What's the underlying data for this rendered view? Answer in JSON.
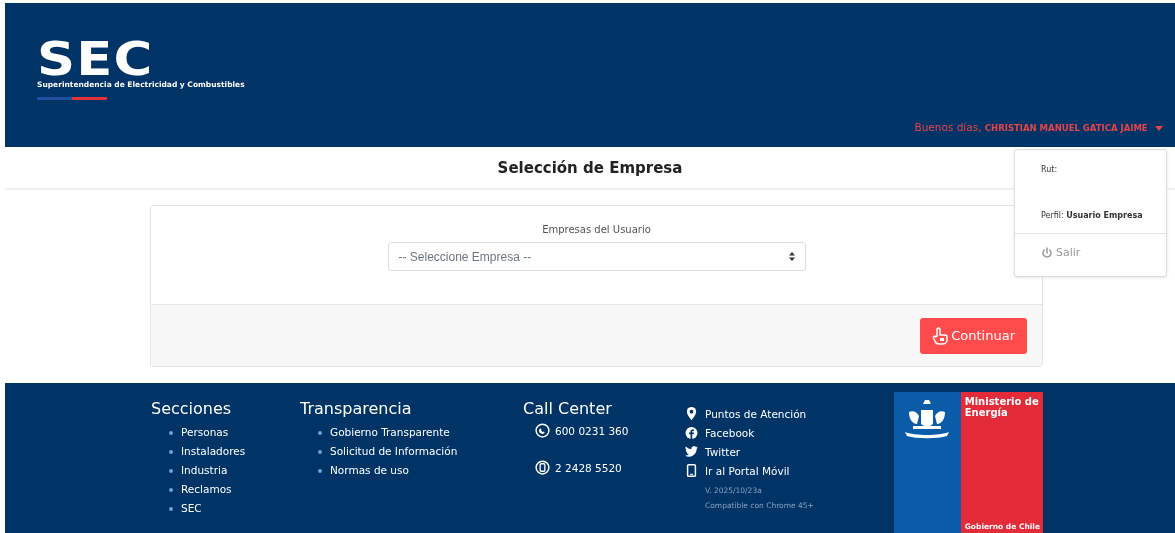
{
  "header": {
    "logo_mark": "SEC",
    "logo_text": "Superintendencia de Electricidad y Combustibles",
    "greeting": "Buenos días,",
    "user_name": "CHRISTIAN MANUEL GATICA JAIME",
    "menu_expanded": true
  },
  "user_menu": {
    "rut_label": "Rut:",
    "profile_label": "Perfil:",
    "profile_value": "Usuario Empresa",
    "logout": "Salir"
  },
  "page_title": "Selección de Empresa",
  "form": {
    "label": "Empresas del Usuario",
    "select_value": "-- Seleccione Empresa --",
    "submit": "Continuar"
  },
  "footer": {
    "sections": {
      "title": "Secciones",
      "items": [
        "Personas",
        "Instaladores",
        "Industria",
        "Reclamos",
        "SEC"
      ]
    },
    "transparency": {
      "title": "Transparencia",
      "items": [
        "Gobierno Transparente",
        "Solicitud de Información",
        "Normas de uso"
      ]
    },
    "call_center": {
      "title": "Call Center",
      "phones": [
        {
          "kind": "phone",
          "number": "600 0231 360"
        },
        {
          "kind": "mobile",
          "number": "2 2428 5520"
        }
      ]
    },
    "links": [
      {
        "kind": "pin",
        "label": "Puntos de Atención"
      },
      {
        "kind": "facebook",
        "label": "Facebook"
      },
      {
        "kind": "twitter",
        "label": "Twitter"
      },
      {
        "kind": "mobile",
        "label": "Ir al Portal Móvil"
      }
    ],
    "version": "V. 2025/10/23a",
    "compat": "Compatible con Chrome 45+",
    "ministry": "Ministerio de Energía",
    "government": "Gobierno de Chile"
  }
}
